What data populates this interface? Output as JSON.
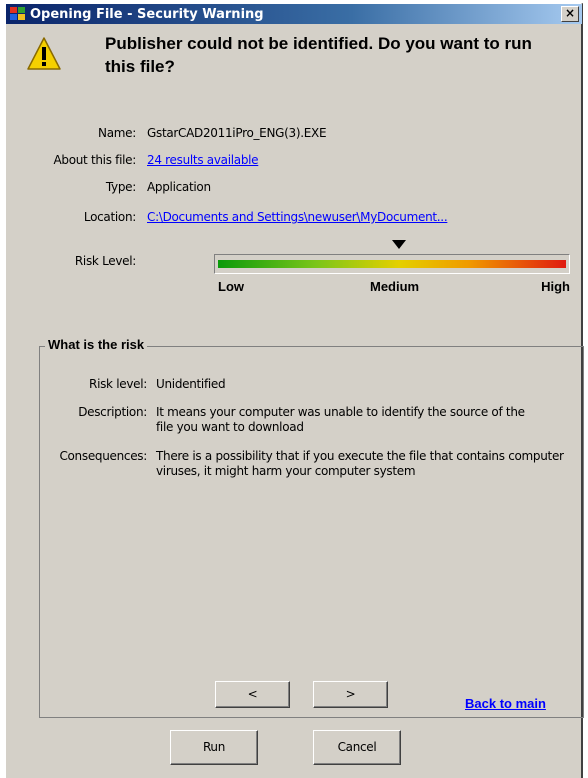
{
  "window": {
    "title": "Opening File - Security Warning",
    "close_glyph": "×"
  },
  "headline": "Publisher could not be identified. Do you want to run this file?",
  "file_info": [
    {
      "label": "Name:",
      "value": "GstarCAD2011iPro_ENG(3).EXE",
      "is_link": false
    },
    {
      "label": "About this file:",
      "value": "24 results available",
      "is_link": true
    },
    {
      "label": "Type:",
      "value": "Application",
      "is_link": false
    },
    {
      "label": "Location:",
      "value": "C:\\Documents and Settings\\newuser\\MyDocument...",
      "is_link": true
    }
  ],
  "risk_level": {
    "label": "Risk Level:",
    "scale": [
      "Low",
      "Medium",
      "High"
    ],
    "indicator_position": 0.53,
    "colors": {
      "low": "#0a9a0a",
      "medium": "#e4d000",
      "high": "#e01a10"
    }
  },
  "risk_group": {
    "title": "What is the risk",
    "rows": [
      {
        "label": "Risk level:",
        "text": "Unidentified"
      },
      {
        "label": "Description:",
        "text": "It means your computer was unable to identify the source of the file you want to download"
      },
      {
        "label": "Consequences:",
        "text": "There is a possibility that if you execute the file that contains computer viruses, it might harm your computer system"
      }
    ]
  },
  "pager": {
    "prev_label": "<",
    "next_label": ">"
  },
  "back_link": "Back to main",
  "buttons": {
    "run": "Run",
    "cancel": "Cancel"
  },
  "icons": {
    "title": "app-icon",
    "warning": "warning-icon",
    "indicator": "triangle-down-icon"
  },
  "colors": {
    "window_bg": "#d4d0c8",
    "title_bar": "#0a246a",
    "link": "#0000ff"
  }
}
